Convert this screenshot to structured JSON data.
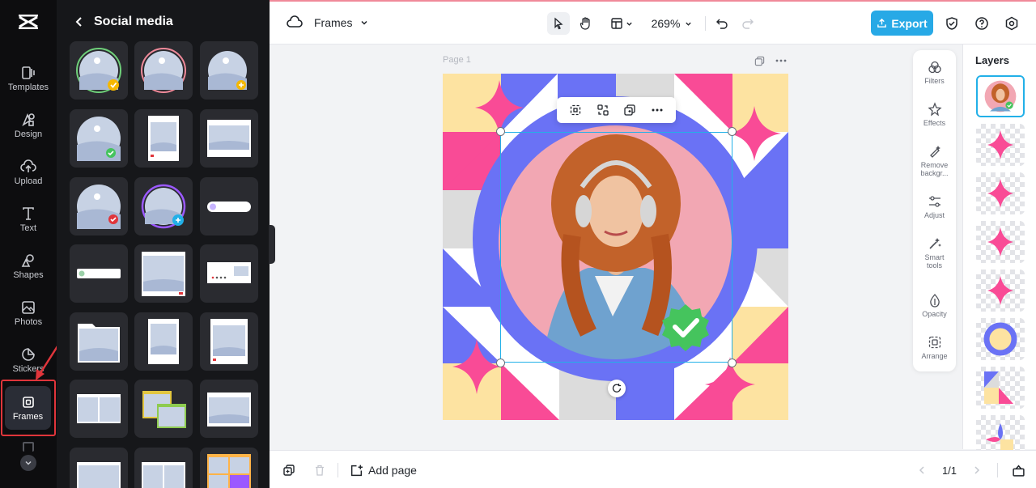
{
  "rail": {
    "items": [
      {
        "label": "Templates",
        "icon": "templates-icon"
      },
      {
        "label": "Design",
        "icon": "design-icon"
      },
      {
        "label": "Upload",
        "icon": "upload-icon"
      },
      {
        "label": "Text",
        "icon": "text-icon"
      },
      {
        "label": "Shapes",
        "icon": "shapes-icon"
      },
      {
        "label": "Photos",
        "icon": "photos-icon"
      },
      {
        "label": "Stickers",
        "icon": "stickers-icon"
      },
      {
        "label": "Frames",
        "icon": "frames-icon"
      }
    ],
    "active": "Frames"
  },
  "panel": {
    "title": "Social media"
  },
  "topbar": {
    "project_name": "Frames",
    "zoom": "269%",
    "export_label": "Export"
  },
  "canvas": {
    "page_label": "Page 1"
  },
  "tools": [
    {
      "label": "Filters",
      "icon": "filters-icon"
    },
    {
      "label": "Effects",
      "icon": "effects-icon"
    },
    {
      "label": "Remove backgr...",
      "icon": "remove-background-icon"
    },
    {
      "label": "Adjust",
      "icon": "adjust-icon"
    },
    {
      "label": "Smart tools",
      "icon": "smart-tools-icon"
    },
    {
      "label": "Opacity",
      "icon": "opacity-icon"
    },
    {
      "label": "Arrange",
      "icon": "arrange-icon"
    }
  ],
  "layers": {
    "title": "Layers"
  },
  "bottombar": {
    "add_page_label": "Add page",
    "page_indicator": "1/1"
  },
  "colors": {
    "accent": "#27a9e6",
    "selection": "#22b0e8",
    "highlight": "#e0353b",
    "pink": "#f94b96",
    "blue": "#6a72f5",
    "yellow": "#fde3a1",
    "green": "#45c45d"
  }
}
